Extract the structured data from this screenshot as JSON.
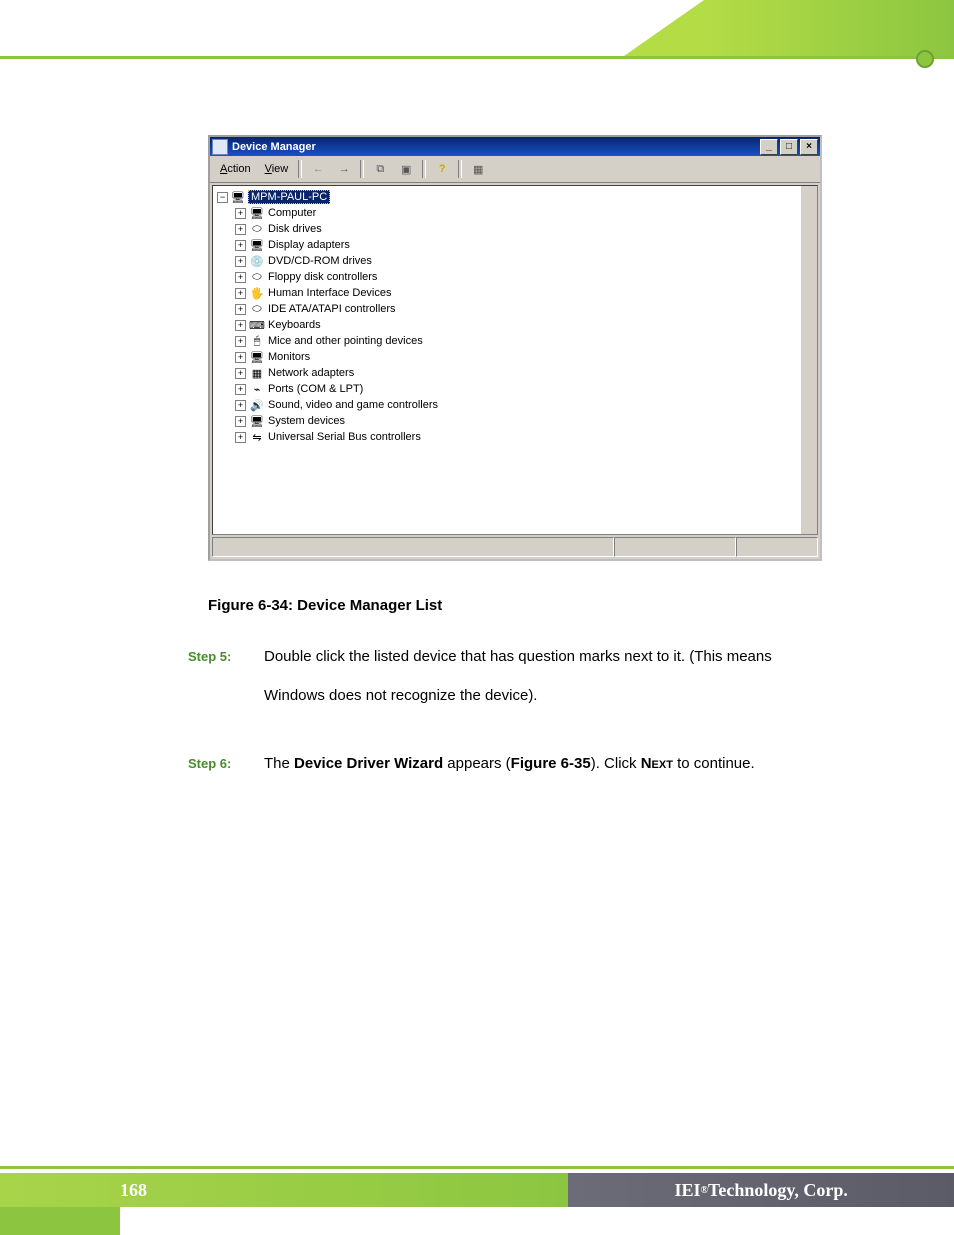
{
  "header": {},
  "screenshot": {
    "title": "Device Manager",
    "win_btn_min": "_",
    "win_btn_max": "□",
    "win_btn_close": "×",
    "menu_action": "Action",
    "menu_view": "View",
    "tb_back": "←",
    "tb_fwd": "→",
    "tb_i1": "⧉",
    "tb_i2": "▣",
    "tb_i3": "?",
    "tb_i4": "▦",
    "root_box": "−",
    "root_label": "MPM-PAUL-PC",
    "nodes": [
      {
        "icon": "🖥",
        "label": "Computer"
      },
      {
        "icon": "⬭",
        "label": "Disk drives"
      },
      {
        "icon": "🖥",
        "label": "Display adapters"
      },
      {
        "icon": "💿",
        "label": "DVD/CD-ROM drives"
      },
      {
        "icon": "⬭",
        "label": "Floppy disk controllers"
      },
      {
        "icon": "🖐",
        "label": "Human Interface Devices"
      },
      {
        "icon": "⬭",
        "label": "IDE ATA/ATAPI controllers"
      },
      {
        "icon": "⌨",
        "label": "Keyboards"
      },
      {
        "icon": "🖱",
        "label": "Mice and other pointing devices"
      },
      {
        "icon": "🖥",
        "label": "Monitors"
      },
      {
        "icon": "▦",
        "label": "Network adapters"
      },
      {
        "icon": "⌁",
        "label": "Ports (COM & LPT)"
      },
      {
        "icon": "🔊",
        "label": "Sound, video and game controllers"
      },
      {
        "icon": "🖥",
        "label": "System devices"
      },
      {
        "icon": "⇋",
        "label": "Universal Serial Bus controllers"
      }
    ],
    "plus": "+"
  },
  "caption": "Figure 6-34: Device Manager List",
  "step5": {
    "label": "Step 5:",
    "line1": "Double click the listed device that has question marks next to it. (This means",
    "line2": "Windows does not recognize the device)."
  },
  "step6": {
    "label": "Step 6:",
    "t1": "The ",
    "b1": "Device Driver Wizard",
    "t2": " appears (",
    "b2": "Figure 6-35",
    "t3": "). Click ",
    "sc": "Next",
    "t4": " to continue."
  },
  "footer": {
    "page": "168",
    "brand_pre": "IEI",
    "brand_sup": "®",
    "brand_post": " Technology, Corp."
  }
}
